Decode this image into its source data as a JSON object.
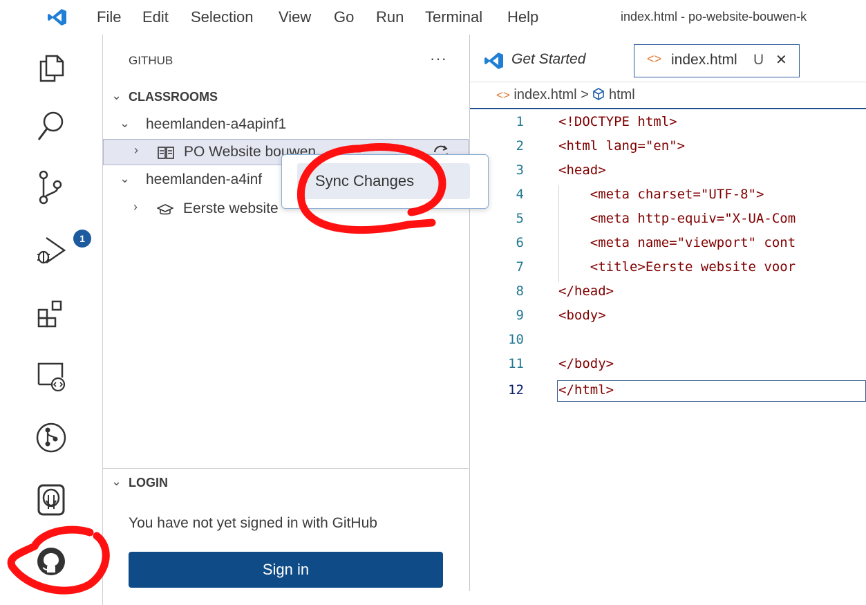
{
  "menubar": {
    "items": [
      "File",
      "Edit",
      "Selection",
      "View",
      "Go",
      "Run",
      "Terminal",
      "Help"
    ],
    "window_title": "index.html - po-website-bouwen-k"
  },
  "activitybar": {
    "icons": [
      "explorer-icon",
      "search-icon",
      "source-control-icon",
      "run-debug-icon",
      "extensions-icon",
      "remote-explorer-icon",
      "git-graph-icon",
      "database-icon",
      "github-icon"
    ],
    "source_control_badge": "1"
  },
  "sidebar": {
    "header": "GITHUB",
    "more_label": "···",
    "classrooms_label": "CLASSROOMS",
    "classroom1": "heemlanden-a4apinf1",
    "assignment1": "PO Website bouwen",
    "classroom2": "heemlanden-a4inf",
    "assignment2": "Eerste website",
    "login_label": "LOGIN",
    "login_message": "You have not yet signed in with GitHub",
    "signin_label": "Sign in"
  },
  "context_menu": {
    "item": "Sync Changes"
  },
  "editor": {
    "tabs": [
      {
        "label": "Get Started"
      },
      {
        "label": "index.html",
        "status": "U",
        "close": "✕"
      }
    ],
    "breadcrumb": {
      "file": "index.html",
      "separator": ">",
      "symbol": "html"
    },
    "lines": [
      {
        "n": "1",
        "code": "<!DOCTYPE html>"
      },
      {
        "n": "2",
        "code": "<html lang=\"en\">"
      },
      {
        "n": "3",
        "code": "<head>"
      },
      {
        "n": "4",
        "code": "    <meta charset=\"UTF-8\">"
      },
      {
        "n": "5",
        "code": "    <meta http-equiv=\"X-UA-Com"
      },
      {
        "n": "6",
        "code": "    <meta name=\"viewport\" cont"
      },
      {
        "n": "7",
        "code": "    <title>Eerste website voor"
      },
      {
        "n": "8",
        "code": "</head>"
      },
      {
        "n": "9",
        "code": "<body>"
      },
      {
        "n": "10",
        "code": ""
      },
      {
        "n": "11",
        "code": "</body>"
      },
      {
        "n": "12",
        "code": "</html>"
      }
    ]
  },
  "colors": {
    "accent": "#0f4b86",
    "annotation": "#ff0000",
    "line_number": "#237893",
    "tag": "#800000"
  }
}
